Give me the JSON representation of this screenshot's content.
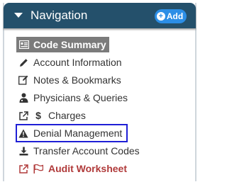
{
  "nav": {
    "title": "Navigation",
    "add_label": "Add",
    "items": [
      {
        "label": "Code Summary",
        "icon": "list-card-icon"
      },
      {
        "label": "Account Information",
        "icon": "pencil-icon"
      },
      {
        "label": "Notes & Bookmarks",
        "icon": "edit-note-icon"
      },
      {
        "label": "Physicians & Queries",
        "icon": "user-md-icon"
      },
      {
        "label": "Charges",
        "icon": "dollar-icon",
        "external": true
      },
      {
        "label": "Denial Management",
        "icon": "warning-icon",
        "selected": true
      },
      {
        "label": "Transfer Account Codes",
        "icon": "download-icon"
      },
      {
        "label": "Audit Worksheet",
        "icon": "flag-icon",
        "external": true
      }
    ]
  },
  "colors": {
    "header_bg": "#24506b",
    "add_button": "#2c8ee6",
    "summary_bg": "#7b7b7b",
    "selected_outline": "#1f1fd6",
    "audit_text": "#b03a3a"
  }
}
